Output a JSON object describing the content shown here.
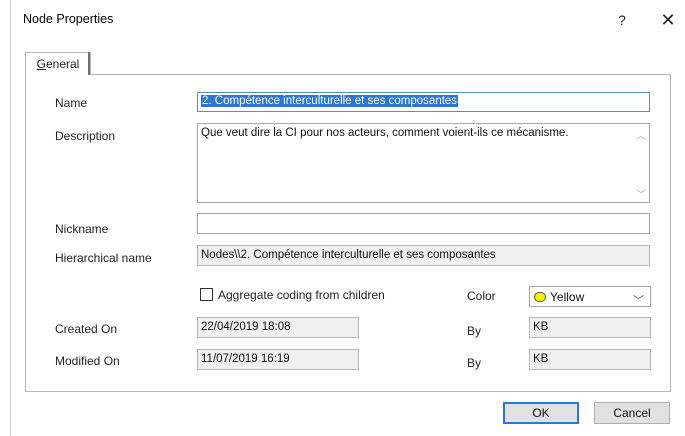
{
  "window": {
    "title": "Node Properties",
    "help_glyph": "?",
    "close_glyph": "✕"
  },
  "tabs": [
    {
      "label_underlined": "G",
      "label_rest": "eneral"
    }
  ],
  "fields": {
    "name": {
      "label": "Name",
      "value": "2. Compétence interculturelle et ses composantes"
    },
    "description": {
      "label": "Description",
      "value": "Que veut dire la CI pour nos acteurs, comment voient-ils ce mécanisme."
    },
    "nickname": {
      "label": "Nickname",
      "value": ""
    },
    "hierarchical_name": {
      "label": "Hierarchical name",
      "value": "Nodes\\\\2. Compétence interculturelle et ses composantes"
    },
    "aggregate": {
      "label": "Aggregate coding from children",
      "checked": false
    },
    "color": {
      "label": "Color",
      "value": "Yellow",
      "swatch": "#f3f300"
    },
    "created_on": {
      "label": "Created On",
      "value": "22/04/2019 18:08",
      "by_label": "By",
      "by_value": "KB"
    },
    "modified_on": {
      "label": "Modified On",
      "value": "11/07/2019 16:19",
      "by_label": "By",
      "by_value": "KB"
    }
  },
  "buttons": {
    "ok": "OK",
    "cancel": "Cancel"
  },
  "icons": {
    "scroll_up": "︿",
    "scroll_down": "﹀",
    "chevron_down": "﹀"
  },
  "colors": {
    "selection": "#2b77d4",
    "focus_border": "#2b77d4"
  }
}
